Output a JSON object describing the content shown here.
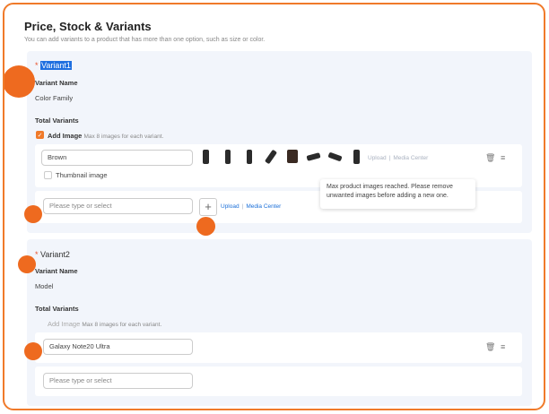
{
  "section": {
    "title": "Price, Stock & Variants",
    "subtitle": "You can add variants to a product that has more than one option, such as size or color."
  },
  "variant1": {
    "required_mark": "*",
    "title": "Variant1",
    "name_label": "Variant Name",
    "name_value": "Color Family",
    "total_label": "Total Variants",
    "add_image_label": "Add Image",
    "add_image_note": "Max 8 images for each variant.",
    "add_image_checked": true,
    "option_value": "Brown",
    "thumbnail_label": "Thumbnail image",
    "upload_label": "Upload",
    "separator": "|",
    "media_center_label": "Media Center",
    "new_option_placeholder": "Please type or select",
    "plus_label": "+",
    "tooltip": "Max product images reached. Please remove unwanted images before adding a new one."
  },
  "variant2": {
    "required_mark": "*",
    "title": "Variant2",
    "name_label": "Variant Name",
    "name_value": "Model",
    "total_label": "Total Variants",
    "add_image_label": "Add Image",
    "add_image_note": "Max 8 images for each variant.",
    "option_value": "Galaxy Note20 Ultra",
    "new_option_placeholder": "Please type or select"
  },
  "icons": {
    "trash": "trash-icon",
    "menu": "drag-menu-icon",
    "check": "check-icon"
  },
  "colors": {
    "accent": "#f07a2a",
    "selection": "#1f6fe0",
    "link": "#1a6fd8",
    "card_bg": "#f2f5fb"
  }
}
